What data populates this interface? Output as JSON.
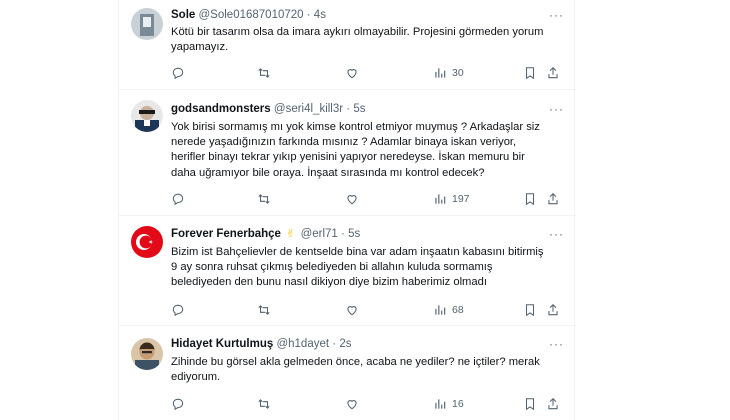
{
  "tweets": [
    {
      "name": "Sole",
      "handle": "@Sole01687010720",
      "separator": "·",
      "time": "4s",
      "badge": "",
      "text": "Kötü bir tasarım olsa da imara aykırı olmayabilir. Projesini görmeden yorum\nyapamayız.",
      "views": "30",
      "avatar_colors": [
        "#7a8a96",
        "#c9d1d6"
      ]
    },
    {
      "name": "godsandmonsters",
      "handle": "@seri4l_kill3r",
      "separator": "·",
      "time": "5s",
      "badge": "",
      "text": "Yok birisi sormamış mı yok kimse kontrol etmiyor muymuş ? Arkadaşlar siz\nnerede yaşadığınızın farkında mısınız ? Adamlar binaya iskan veriyor,\nherifler binayı tekrar yıkıp yenisini yapıyor neredeyse. İskan memuru bir\ndaha uğramıyor bile oraya. İnşaat sırasında mı kontrol edecek?",
      "views": "197",
      "avatar_colors": [
        "#1d3557",
        "#e8e8e8"
      ]
    },
    {
      "name": "Forever Fenerbahçe",
      "handle": "@erl71",
      "separator": "·",
      "time": "5s",
      "badge": "✌",
      "text": "Bizim ist Bahçelievler de kentselde bina var adam inşaatın kabasını bitirmiş\n9 ay sonra ruhsat çıkmış belediyeden bi allahın kuluda sormamış\nbelediyeden den bunu nasıl dikiyon diye bizim haberimiz olmadı",
      "views": "68",
      "avatar_colors": [
        "#e30a17",
        "#ffffff"
      ]
    },
    {
      "name": "Hidayet Kurtulmuş",
      "handle": "@h1dayet",
      "separator": "·",
      "time": "2s",
      "badge": "",
      "text": "Zihinde bu görsel akla gelmeden önce, acaba ne yediler? ne içtiler? merak\nediyorum.",
      "views": "16",
      "avatar_colors": [
        "#6b5a4a",
        "#d9c6a8"
      ]
    }
  ],
  "icons": {
    "more": "more-icon",
    "reply": "reply-icon",
    "retweet": "retweet-icon",
    "like": "like-icon",
    "views": "views-icon",
    "bookmark": "bookmark-icon",
    "share": "share-icon"
  },
  "colors": {
    "text": "#0f1419",
    "secondary": "#536471",
    "border": "#eff3f4"
  },
  "more_label": "···"
}
